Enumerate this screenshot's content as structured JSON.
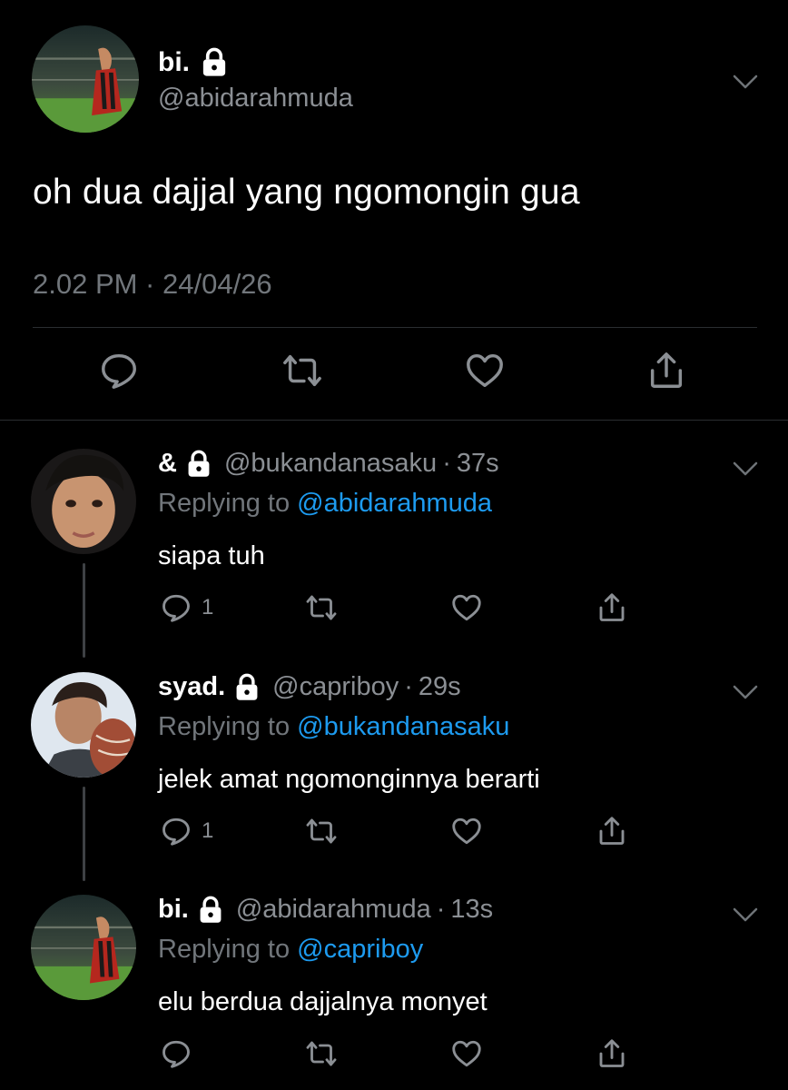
{
  "main_tweet": {
    "display_name": "bi.",
    "handle": "@abidarahmuda",
    "text": "oh dua dajjal yang ngomongin gua",
    "timestamp": "2.02 PM · 24/04/26",
    "protected_icon": "lock-icon",
    "actions": [
      "reply-icon",
      "retweet-icon",
      "like-icon",
      "share-icon"
    ]
  },
  "replies": [
    {
      "display_name": "&",
      "handle": "@bukandanasaku",
      "time": "37s",
      "replying_prefix": "Replying to ",
      "replying_to": "@abidarahmuda",
      "text": "siapa tuh",
      "reply_count": "1"
    },
    {
      "display_name": "syad.",
      "handle": "@capriboy",
      "time": "29s",
      "replying_prefix": "Replying to ",
      "replying_to": "@bukandanasaku",
      "text": "jelek amat ngomonginnya berarti",
      "reply_count": "1"
    },
    {
      "display_name": "bi.",
      "handle": "@abidarahmuda",
      "time": "13s",
      "replying_prefix": "Replying to ",
      "replying_to": "@capriboy",
      "text": "elu berdua dajjalnya monyet",
      "reply_count": ""
    }
  ],
  "separator": "·",
  "colors": {
    "background": "#000000",
    "primary_text": "#ffffff",
    "secondary_text": "#71767b",
    "mention": "#1d9bf0",
    "divider": "#2a2d30",
    "icon": "#8b8f94"
  }
}
